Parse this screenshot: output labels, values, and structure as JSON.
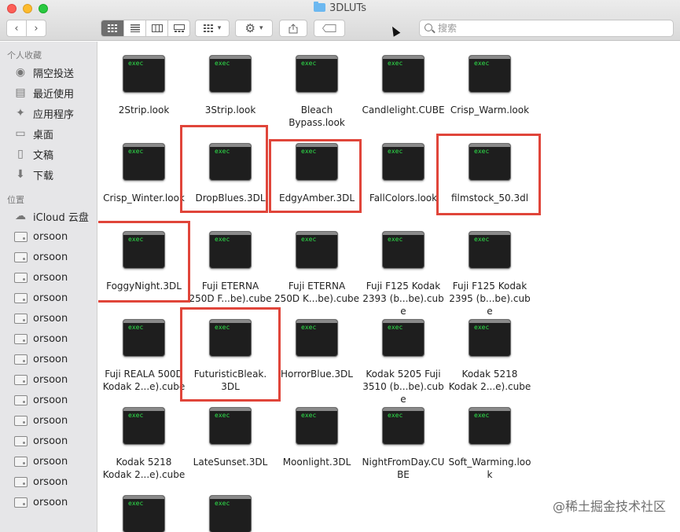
{
  "window": {
    "title": "3DLUTs"
  },
  "search": {
    "placeholder": "搜索"
  },
  "sidebar": {
    "favorites_header": "个人收藏",
    "favorites": [
      {
        "label": "隔空投送",
        "icon": "airdrop-icon"
      },
      {
        "label": "最近使用",
        "icon": "recents-icon"
      },
      {
        "label": "应用程序",
        "icon": "applications-icon"
      },
      {
        "label": "桌面",
        "icon": "desktop-icon"
      },
      {
        "label": "文稿",
        "icon": "documents-icon"
      },
      {
        "label": "下载",
        "icon": "downloads-icon"
      }
    ],
    "locations_header": "位置",
    "locations": [
      "iCloud 云盘",
      "orsoon",
      "orsoon",
      "orsoon",
      "orsoon",
      "orsoon",
      "orsoon",
      "orsoon",
      "orsoon",
      "orsoon",
      "orsoon",
      "orsoon",
      "orsoon",
      "orsoon",
      "orsoon"
    ]
  },
  "files": [
    [
      "2Strip.look"
    ],
    [
      "3Strip.look"
    ],
    [
      "Bleach",
      "Bypass.look"
    ],
    [
      "Candlelight.CUBE"
    ],
    [
      "Crisp_Warm.look"
    ],
    [
      "Crisp_Winter.look"
    ],
    [
      "DropBlues.3DL"
    ],
    [
      "EdgyAmber.3DL"
    ],
    [
      "FallColors.look"
    ],
    [
      "filmstock_50.3dl"
    ],
    [
      "FoggyNight.3DL"
    ],
    [
      "Fuji ETERNA",
      "250D F...be).cube"
    ],
    [
      "Fuji ETERNA",
      "250D K...be).cube"
    ],
    [
      "Fuji F125 Kodak",
      "2393 (b...be).cube"
    ],
    [
      "Fuji F125 Kodak",
      "2395 (b...be).cube"
    ],
    [
      "Fuji REALA 500D",
      "Kodak 2...e).cube"
    ],
    [
      "FuturisticBleak.",
      "3DL"
    ],
    [
      "HorrorBlue.3DL"
    ],
    [
      "Kodak 5205 Fuji",
      "3510 (b...be).cube"
    ],
    [
      "Kodak 5218",
      "Kodak 2...e).cube"
    ],
    [
      "Kodak 5218",
      "Kodak 2...e).cube"
    ],
    [
      "LateSunset.3DL"
    ],
    [
      "Moonlight.3DL"
    ],
    [
      "NightFromDay.CU",
      "BE"
    ],
    [
      "Soft_Warming.loo",
      "k"
    ],
    [],
    []
  ],
  "icon_text": "exec",
  "highlighted_files": [
    6,
    7,
    9,
    10,
    16
  ],
  "watermark": "@稀土掘金技术社区",
  "colors": {
    "highlight": "#e0453a",
    "exec_text": "#2ee34a",
    "sidebar_bg": "#e6e6e8"
  }
}
